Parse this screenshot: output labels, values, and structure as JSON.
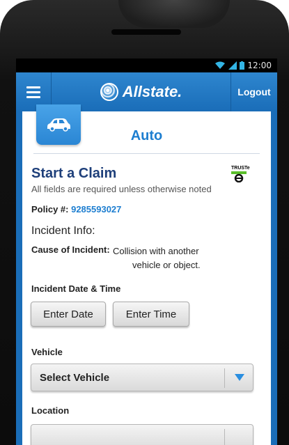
{
  "status_bar": {
    "time": "12:00"
  },
  "app_bar": {
    "brand": "Allstate.",
    "logout_label": "Logout"
  },
  "section": {
    "title": "Auto"
  },
  "claim": {
    "title": "Start a Claim",
    "required_note": "All fields are required unless otherwise noted",
    "truste_label": "TRUSTe",
    "policy_label": "Policy #:",
    "policy_number": "9285593027"
  },
  "incident": {
    "heading": "Incident Info:",
    "cause_label": "Cause of Incident:",
    "cause_value_line1": "Collision with another",
    "cause_value_line2": "vehicle or object.",
    "datetime_label": "Incident Date & Time",
    "enter_date_label": "Enter Date",
    "enter_time_label": "Enter Time"
  },
  "vehicle": {
    "label": "Vehicle",
    "selected": "Select Vehicle"
  },
  "location": {
    "label": "Location"
  },
  "colors": {
    "brand_blue": "#1a6db8",
    "accent_blue": "#1d7ed0",
    "title_navy": "#1e3f7a"
  }
}
